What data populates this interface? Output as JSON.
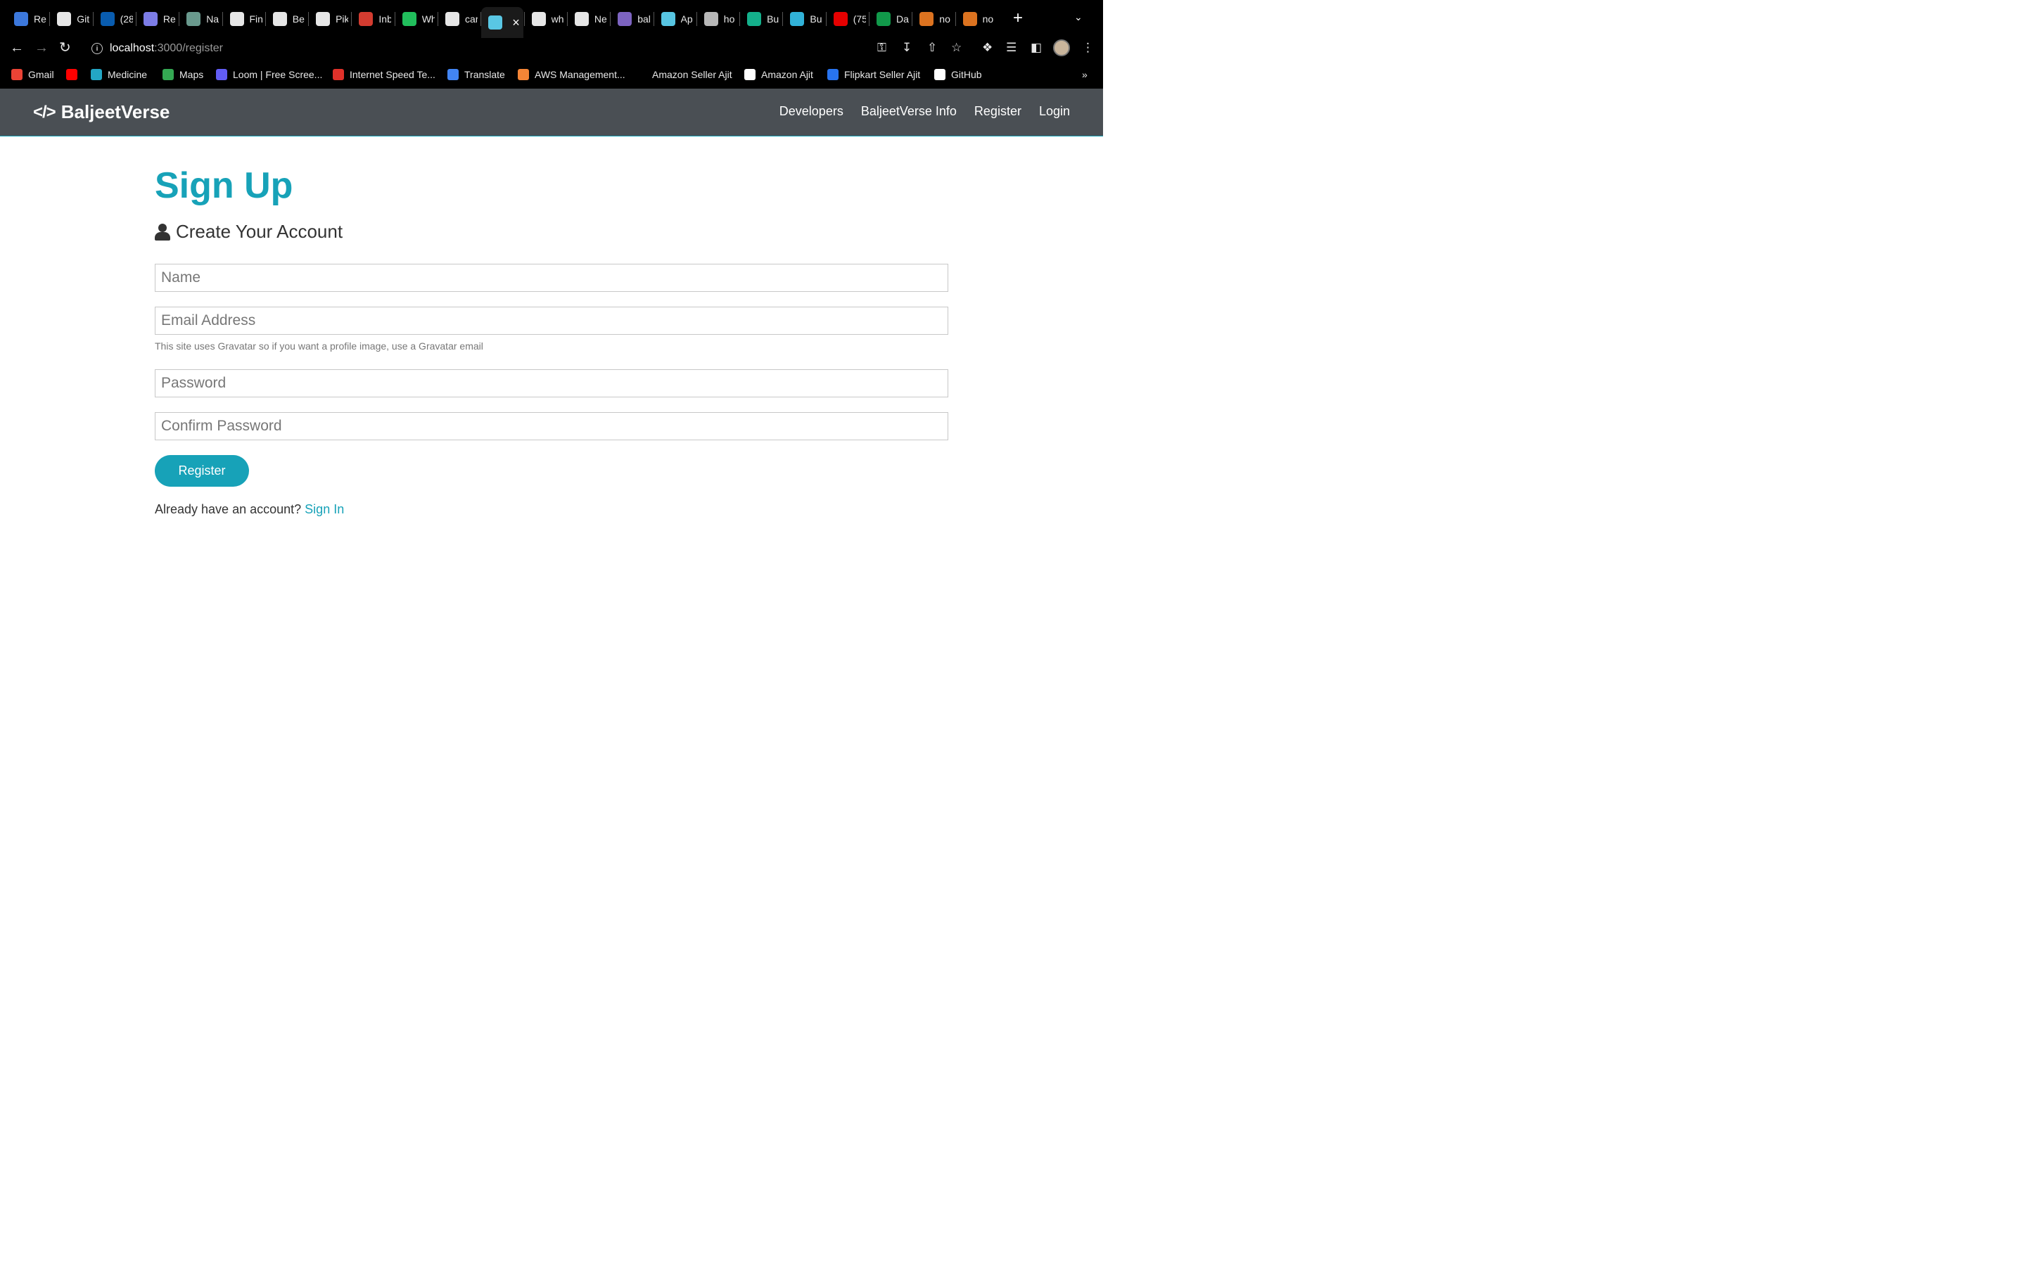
{
  "browser": {
    "tabs": [
      {
        "title": "Re",
        "icon": "docs-icon",
        "color": "#4285f4"
      },
      {
        "title": "Git",
        "icon": "github-icon",
        "color": "#ffffff"
      },
      {
        "title": "(28",
        "icon": "linkedin-icon",
        "color": "#0a66c2"
      },
      {
        "title": "Re",
        "icon": "globe-icon",
        "color": "#8a8aff"
      },
      {
        "title": "Na",
        "icon": "openai-icon",
        "color": "#74aa9c"
      },
      {
        "title": "Fin",
        "icon": "w-icon",
        "color": "#ffffff"
      },
      {
        "title": "Be",
        "icon": "w-icon",
        "color": "#ffffff"
      },
      {
        "title": "Pik",
        "icon": "cloud-icon",
        "color": "#ffffff"
      },
      {
        "title": "Inb",
        "icon": "gmail-icon",
        "color": "#ea4335"
      },
      {
        "title": "Wh",
        "icon": "whatsapp-icon",
        "color": "#25d366"
      },
      {
        "title": "car",
        "icon": "google-icon",
        "color": "#ffffff"
      },
      {
        "title": "",
        "icon": "react-icon",
        "color": "#61dafb",
        "active": true
      },
      {
        "title": "wh",
        "icon": "google-icon",
        "color": "#ffffff"
      },
      {
        "title": "Ne",
        "icon": "chrome-icon",
        "color": "#ffffff"
      },
      {
        "title": "bal",
        "icon": "circle-icon",
        "color": "#8b6fd6"
      },
      {
        "title": "Ap",
        "icon": "react-icon",
        "color": "#61dafb"
      },
      {
        "title": "ho",
        "icon": "circle-icon",
        "color": "#cccccc"
      },
      {
        "title": "Bu",
        "icon": "diamond-icon",
        "color": "#16c39a"
      },
      {
        "title": "Bu",
        "icon": "slack-icon",
        "color": "#36c5f0"
      },
      {
        "title": "(75",
        "icon": "youtube-icon",
        "color": "#ff0000"
      },
      {
        "title": "Da",
        "icon": "mongodb-icon",
        "color": "#13aa52"
      },
      {
        "title": "no",
        "icon": "stackoverflow-icon",
        "color": "#f48024"
      },
      {
        "title": "no",
        "icon": "stackoverflow-icon",
        "color": "#f48024"
      }
    ],
    "url_host": "localhost",
    "url_path": ":3000/register",
    "bookmarks": [
      {
        "label": "Gmail",
        "icon": "gmail-icon",
        "color": "#ea4335"
      },
      {
        "label": "",
        "icon": "youtube-icon",
        "color": "#ff0000"
      },
      {
        "label": "Medicine",
        "icon": "medicine-icon",
        "color": "#23a6c4"
      },
      {
        "label": "Maps",
        "icon": "maps-pin-icon",
        "color": "#34a853"
      },
      {
        "label": "Loom | Free Scree...",
        "icon": "loom-icon",
        "color": "#625df5"
      },
      {
        "label": "Internet Speed Te...",
        "icon": "speedtest-icon",
        "color": "#e0312a"
      },
      {
        "label": "Translate",
        "icon": "translate-icon",
        "color": "#4285f4"
      },
      {
        "label": "AWS Management...",
        "icon": "aws-icon",
        "color": "#f58536"
      },
      {
        "label": "Amazon Seller Ajit",
        "icon": "amazon-icon",
        "color": "#000000"
      },
      {
        "label": "Amazon Ajit",
        "icon": "amazon-icon",
        "color": "#ffffff"
      },
      {
        "label": "Flipkart Seller Ajit",
        "icon": "flipkart-icon",
        "color": "#2874f0"
      },
      {
        "label": "GitHub",
        "icon": "github-icon",
        "color": "#ffffff"
      }
    ],
    "bookmarks_more": "»"
  },
  "navbar": {
    "brand": "BaljeetVerse",
    "links": [
      "Developers",
      "BaljeetVerse Info",
      "Register",
      "Login"
    ]
  },
  "page": {
    "title": "Sign Up",
    "lead": "Create Your Account",
    "name_placeholder": "Name",
    "email_placeholder": "Email Address",
    "email_help": "This site uses Gravatar so if you want a profile image, use a Gravatar email",
    "password_placeholder": "Password",
    "confirm_placeholder": "Confirm Password",
    "submit_label": "Register",
    "signin_prompt": "Already have an account?",
    "signin_link": "Sign In"
  },
  "colors": {
    "accent": "#17a2b8",
    "navbar_bg": "#4a4f54"
  }
}
